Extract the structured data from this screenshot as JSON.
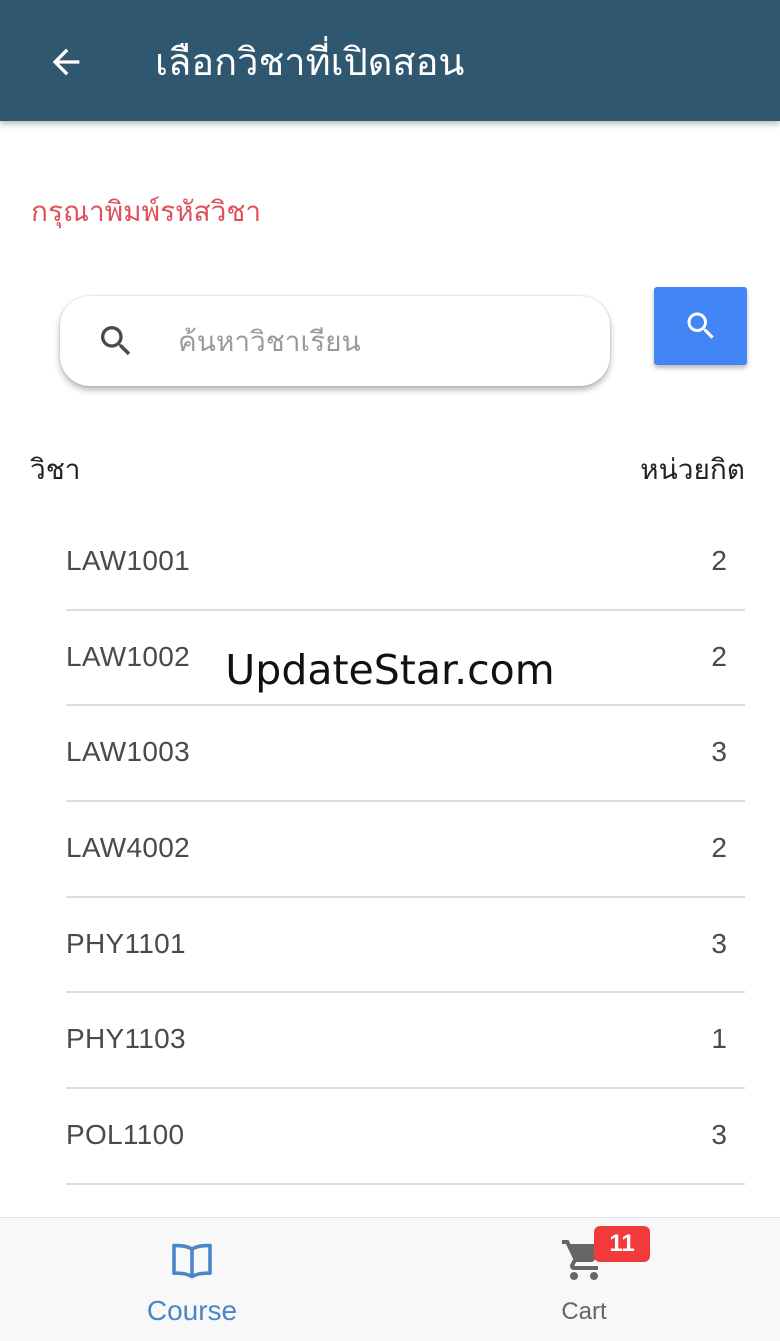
{
  "header": {
    "title": "เลือกวิชาที่เปิดสอน",
    "back_icon": "arrow-left-icon"
  },
  "search": {
    "prompt": "กรุณาพิมพ์รหัสวิชา",
    "placeholder": "ค้นหาวิชาเรียน",
    "value": "",
    "field_icon": "search-icon",
    "button_icon": "search-icon"
  },
  "table": {
    "headers": {
      "subject": "วิชา",
      "credits": "หน่วยกิต"
    },
    "rows": [
      {
        "code": "LAW1001",
        "credits": "2"
      },
      {
        "code": "LAW1002",
        "credits": "2"
      },
      {
        "code": "LAW1003",
        "credits": "3"
      },
      {
        "code": "LAW4002",
        "credits": "2"
      },
      {
        "code": "PHY1101",
        "credits": "3"
      },
      {
        "code": "PHY1103",
        "credits": "1"
      },
      {
        "code": "POL1100",
        "credits": "3"
      }
    ]
  },
  "watermark": "UpdateStar.com",
  "bottom_nav": {
    "course": {
      "label": "Course",
      "icon": "book-open-icon"
    },
    "cart": {
      "label": "Cart",
      "icon": "shopping-cart-icon",
      "badge": "11"
    }
  },
  "colors": {
    "app_bar": "#2f5870",
    "prompt": "#e0505a",
    "search_button": "#4286f5",
    "nav_active": "#4a86c8",
    "badge": "#f23a3a"
  }
}
